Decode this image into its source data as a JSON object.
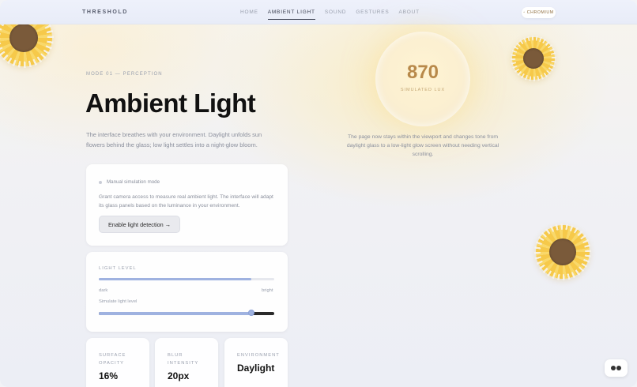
{
  "header": {
    "brand": "THRESHOLD",
    "nav": [
      "HOME",
      "AMBIENT LIGHT",
      "SOUND",
      "GESTURES",
      "ABOUT"
    ],
    "active_nav": "AMBIENT LIGHT",
    "browser_pill": "◦ CHROMIUM"
  },
  "hero": {
    "mode": "MODE 01 — PERCEPTION",
    "title": "Ambient Light",
    "description": "The interface breathes with your environment. Daylight unfolds sun flowers behind the glass; low light settles into a night-glow bloom."
  },
  "detection_card": {
    "status": "Manual simulation mode",
    "body": "Grant camera access to measure real ambient light. The interface will adapt its glass panels based on the luminance in your environment.",
    "button": "Enable light detection →"
  },
  "light_card": {
    "label": "LIGHT LEVEL",
    "level_fraction": 0.87,
    "dark": "dark",
    "bright": "bright",
    "slider_label": "Simulate light level",
    "slider_value": 0.87
  },
  "stats": [
    {
      "label": "SURFACE OPACITY",
      "value": "16%"
    },
    {
      "label": "BLUR INTENSITY",
      "value": "20px"
    },
    {
      "label": "ENVIRONMENT",
      "value": "Daylight"
    }
  ],
  "orb": {
    "value": "870",
    "label": "SIMULATED LUX"
  },
  "note": "The page now stays within the viewport and changes tone from daylight glass to a low-light glow screen without needing vertical scrolling.",
  "colors": {
    "accent": "#9fb2e0",
    "petal": "#f6c94a",
    "lux_text": "#b8894a"
  }
}
